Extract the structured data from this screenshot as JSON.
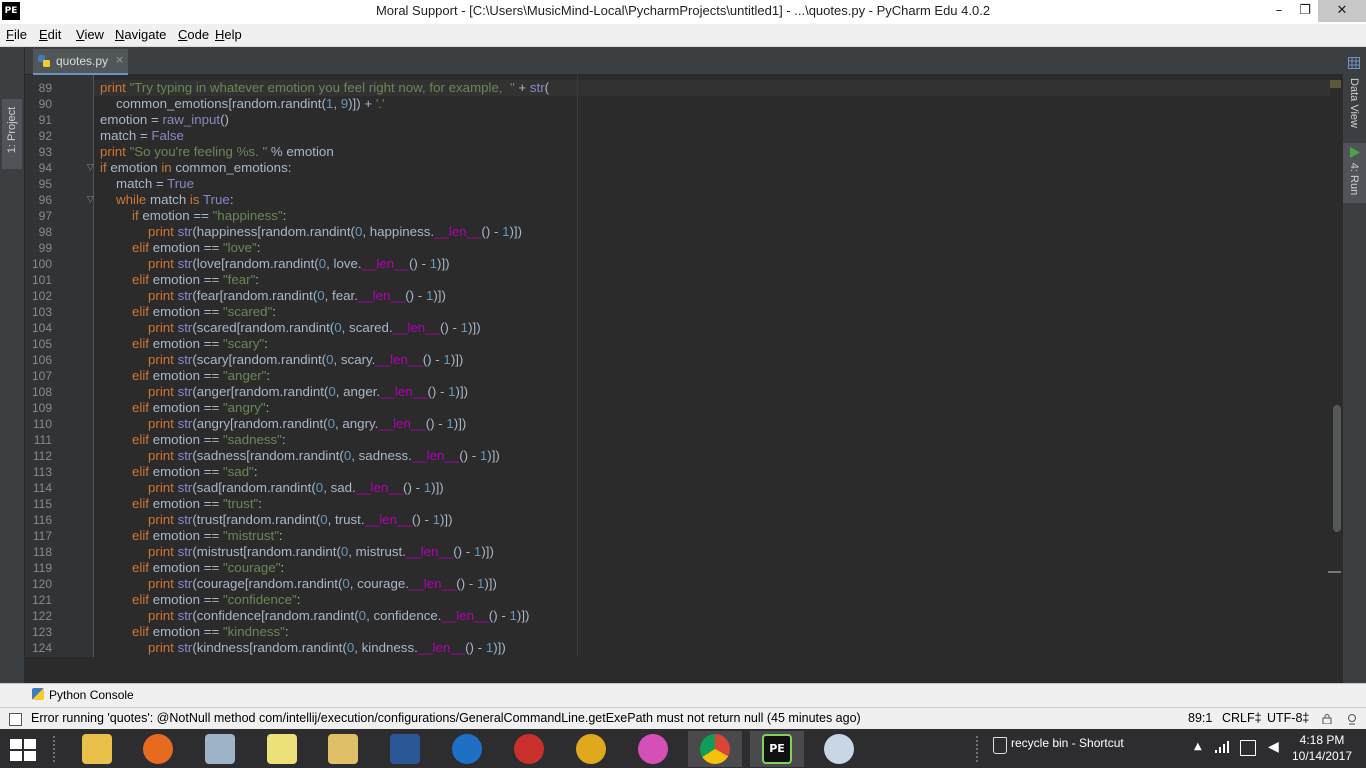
{
  "window": {
    "app_logo": "PE",
    "title": "Moral Support - [C:\\Users\\MusicMind-Local\\PycharmProjects\\untitled1] - ...\\quotes.py - PyCharm Edu 4.0.2",
    "minimize": "–",
    "maximize": "❐",
    "close": "✕"
  },
  "menu": {
    "file": {
      "u": "F",
      "rest": "ile"
    },
    "edit": {
      "u": "E",
      "rest": "dit"
    },
    "view": {
      "u": "V",
      "rest": "iew"
    },
    "navigate": {
      "u": "N",
      "rest": "avigate"
    },
    "code": {
      "u": "C",
      "rest": "ode"
    },
    "help": {
      "u": "H",
      "rest": "elp"
    }
  },
  "tool_windows": {
    "project": "1: Project",
    "data_view": "Data View",
    "run": "4: Run",
    "python_console": "Python Console"
  },
  "editor": {
    "tab_label": "quotes.py",
    "tab_close": "×",
    "line_numbers": [
      "89",
      "90",
      "91",
      "92",
      "93",
      "94",
      "95",
      "96",
      "97",
      "98",
      "99",
      "100",
      "101",
      "102",
      "103",
      "104",
      "105",
      "106",
      "107",
      "108",
      "109",
      "110",
      "111",
      "112",
      "113",
      "114",
      "115",
      "116",
      "117",
      "118",
      "119",
      "120",
      "121",
      "122",
      "123",
      "124"
    ],
    "lines": [
      {
        "indent": 0,
        "tokens": [
          [
            "kw",
            "print "
          ],
          [
            "st",
            "\"Try typing in whatever emotion you feel right now, for example,  \""
          ],
          [
            "op",
            " + "
          ],
          [
            "bi",
            "str"
          ],
          [
            "op",
            "("
          ]
        ]
      },
      {
        "indent": 1,
        "tokens": [
          [
            "op",
            "common_emotions[random.randint("
          ],
          [
            "nm",
            "1"
          ],
          [
            "op",
            ", "
          ],
          [
            "nm",
            "9"
          ],
          [
            "op",
            ")]) + "
          ],
          [
            "st",
            "'.'"
          ]
        ]
      },
      {
        "indent": 0,
        "tokens": [
          [
            "op",
            "emotion = "
          ],
          [
            "bi",
            "raw_input"
          ],
          [
            "op",
            "()"
          ]
        ]
      },
      {
        "indent": 0,
        "tokens": [
          [
            "op",
            "match = "
          ],
          [
            "bi",
            "False"
          ]
        ]
      },
      {
        "indent": 0,
        "tokens": [
          [
            "kw",
            "print "
          ],
          [
            "st",
            "\"So you're feeling %s. \""
          ],
          [
            "op",
            " % emotion"
          ]
        ]
      },
      {
        "indent": 0,
        "tokens": [
          [
            "kw",
            "if "
          ],
          [
            "op",
            "emotion "
          ],
          [
            "kw",
            "in "
          ],
          [
            "op",
            "common_emotions:"
          ]
        ]
      },
      {
        "indent": 1,
        "tokens": [
          [
            "op",
            "match = "
          ],
          [
            "bi",
            "True"
          ]
        ]
      },
      {
        "indent": 1,
        "tokens": [
          [
            "kw",
            "while "
          ],
          [
            "op",
            "match "
          ],
          [
            "kw",
            "is "
          ],
          [
            "bi",
            "True"
          ],
          [
            "op",
            ":"
          ]
        ]
      },
      {
        "indent": 2,
        "tokens": [
          [
            "kw",
            "if "
          ],
          [
            "op",
            "emotion == "
          ],
          [
            "st",
            "\"happiness\""
          ],
          [
            "op",
            ":"
          ]
        ]
      },
      {
        "indent": 3,
        "tokens": [
          [
            "kw",
            "print "
          ],
          [
            "bi",
            "str"
          ],
          [
            "op",
            "(happiness[random.randint("
          ],
          [
            "nm",
            "0"
          ],
          [
            "op",
            ", happiness."
          ],
          [
            "du",
            "__len__"
          ],
          [
            "op",
            "() - "
          ],
          [
            "nm",
            "1"
          ],
          [
            "op",
            ")])"
          ]
        ]
      },
      {
        "indent": 2,
        "tokens": [
          [
            "kw",
            "elif "
          ],
          [
            "op",
            "emotion == "
          ],
          [
            "st",
            "\"love\""
          ],
          [
            "op",
            ":"
          ]
        ]
      },
      {
        "indent": 3,
        "tokens": [
          [
            "kw",
            "print "
          ],
          [
            "bi",
            "str"
          ],
          [
            "op",
            "(love[random.randint("
          ],
          [
            "nm",
            "0"
          ],
          [
            "op",
            ", love."
          ],
          [
            "du",
            "__len__"
          ],
          [
            "op",
            "() - "
          ],
          [
            "nm",
            "1"
          ],
          [
            "op",
            ")])"
          ]
        ]
      },
      {
        "indent": 2,
        "tokens": [
          [
            "kw",
            "elif "
          ],
          [
            "op",
            "emotion == "
          ],
          [
            "st",
            "\"fear\""
          ],
          [
            "op",
            ":"
          ]
        ]
      },
      {
        "indent": 3,
        "tokens": [
          [
            "kw",
            "print "
          ],
          [
            "bi",
            "str"
          ],
          [
            "op",
            "(fear[random.randint("
          ],
          [
            "nm",
            "0"
          ],
          [
            "op",
            ", fear."
          ],
          [
            "du",
            "__len__"
          ],
          [
            "op",
            "() - "
          ],
          [
            "nm",
            "1"
          ],
          [
            "op",
            ")])"
          ]
        ]
      },
      {
        "indent": 2,
        "tokens": [
          [
            "kw",
            "elif "
          ],
          [
            "op",
            "emotion == "
          ],
          [
            "st",
            "\"scared\""
          ],
          [
            "op",
            ":"
          ]
        ]
      },
      {
        "indent": 3,
        "tokens": [
          [
            "kw",
            "print "
          ],
          [
            "bi",
            "str"
          ],
          [
            "op",
            "(scared[random.randint("
          ],
          [
            "nm",
            "0"
          ],
          [
            "op",
            ", scared."
          ],
          [
            "du",
            "__len__"
          ],
          [
            "op",
            "() - "
          ],
          [
            "nm",
            "1"
          ],
          [
            "op",
            ")])"
          ]
        ]
      },
      {
        "indent": 2,
        "tokens": [
          [
            "kw",
            "elif "
          ],
          [
            "op",
            "emotion == "
          ],
          [
            "st",
            "\"scary\""
          ],
          [
            "op",
            ":"
          ]
        ]
      },
      {
        "indent": 3,
        "tokens": [
          [
            "kw",
            "print "
          ],
          [
            "bi",
            "str"
          ],
          [
            "op",
            "(scary[random.randint("
          ],
          [
            "nm",
            "0"
          ],
          [
            "op",
            ", scary."
          ],
          [
            "du",
            "__len__"
          ],
          [
            "op",
            "() - "
          ],
          [
            "nm",
            "1"
          ],
          [
            "op",
            ")])"
          ]
        ]
      },
      {
        "indent": 2,
        "tokens": [
          [
            "kw",
            "elif "
          ],
          [
            "op",
            "emotion == "
          ],
          [
            "st",
            "\"anger\""
          ],
          [
            "op",
            ":"
          ]
        ]
      },
      {
        "indent": 3,
        "tokens": [
          [
            "kw",
            "print "
          ],
          [
            "bi",
            "str"
          ],
          [
            "op",
            "(anger[random.randint("
          ],
          [
            "nm",
            "0"
          ],
          [
            "op",
            ", anger."
          ],
          [
            "du",
            "__len__"
          ],
          [
            "op",
            "() - "
          ],
          [
            "nm",
            "1"
          ],
          [
            "op",
            ")])"
          ]
        ]
      },
      {
        "indent": 2,
        "tokens": [
          [
            "kw",
            "elif "
          ],
          [
            "op",
            "emotion == "
          ],
          [
            "st",
            "\"angry\""
          ],
          [
            "op",
            ":"
          ]
        ]
      },
      {
        "indent": 3,
        "tokens": [
          [
            "kw",
            "print "
          ],
          [
            "bi",
            "str"
          ],
          [
            "op",
            "(angry[random.randint("
          ],
          [
            "nm",
            "0"
          ],
          [
            "op",
            ", angry."
          ],
          [
            "du",
            "__len__"
          ],
          [
            "op",
            "() - "
          ],
          [
            "nm",
            "1"
          ],
          [
            "op",
            ")])"
          ]
        ]
      },
      {
        "indent": 2,
        "tokens": [
          [
            "kw",
            "elif "
          ],
          [
            "op",
            "emotion == "
          ],
          [
            "st",
            "\"sadness\""
          ],
          [
            "op",
            ":"
          ]
        ]
      },
      {
        "indent": 3,
        "tokens": [
          [
            "kw",
            "print "
          ],
          [
            "bi",
            "str"
          ],
          [
            "op",
            "(sadness[random.randint("
          ],
          [
            "nm",
            "0"
          ],
          [
            "op",
            ", sadness."
          ],
          [
            "du",
            "__len__"
          ],
          [
            "op",
            "() - "
          ],
          [
            "nm",
            "1"
          ],
          [
            "op",
            ")])"
          ]
        ]
      },
      {
        "indent": 2,
        "tokens": [
          [
            "kw",
            "elif "
          ],
          [
            "op",
            "emotion == "
          ],
          [
            "st",
            "\"sad\""
          ],
          [
            "op",
            ":"
          ]
        ]
      },
      {
        "indent": 3,
        "tokens": [
          [
            "kw",
            "print "
          ],
          [
            "bi",
            "str"
          ],
          [
            "op",
            "(sad[random.randint("
          ],
          [
            "nm",
            "0"
          ],
          [
            "op",
            ", sad."
          ],
          [
            "du",
            "__len__"
          ],
          [
            "op",
            "() - "
          ],
          [
            "nm",
            "1"
          ],
          [
            "op",
            ")])"
          ]
        ]
      },
      {
        "indent": 2,
        "tokens": [
          [
            "kw",
            "elif "
          ],
          [
            "op",
            "emotion == "
          ],
          [
            "st",
            "\"trust\""
          ],
          [
            "op",
            ":"
          ]
        ]
      },
      {
        "indent": 3,
        "tokens": [
          [
            "kw",
            "print "
          ],
          [
            "bi",
            "str"
          ],
          [
            "op",
            "(trust[random.randint("
          ],
          [
            "nm",
            "0"
          ],
          [
            "op",
            ", trust."
          ],
          [
            "du",
            "__len__"
          ],
          [
            "op",
            "() - "
          ],
          [
            "nm",
            "1"
          ],
          [
            "op",
            ")])"
          ]
        ]
      },
      {
        "indent": 2,
        "tokens": [
          [
            "kw",
            "elif "
          ],
          [
            "op",
            "emotion == "
          ],
          [
            "st",
            "\"mistrust\""
          ],
          [
            "op",
            ":"
          ]
        ]
      },
      {
        "indent": 3,
        "tokens": [
          [
            "kw",
            "print "
          ],
          [
            "bi",
            "str"
          ],
          [
            "op",
            "(mistrust[random.randint("
          ],
          [
            "nm",
            "0"
          ],
          [
            "op",
            ", mistrust."
          ],
          [
            "du",
            "__len__"
          ],
          [
            "op",
            "() - "
          ],
          [
            "nm",
            "1"
          ],
          [
            "op",
            ")])"
          ]
        ]
      },
      {
        "indent": 2,
        "tokens": [
          [
            "kw",
            "elif "
          ],
          [
            "op",
            "emotion == "
          ],
          [
            "st",
            "\"courage\""
          ],
          [
            "op",
            ":"
          ]
        ]
      },
      {
        "indent": 3,
        "tokens": [
          [
            "kw",
            "print "
          ],
          [
            "bi",
            "str"
          ],
          [
            "op",
            "(courage[random.randint("
          ],
          [
            "nm",
            "0"
          ],
          [
            "op",
            ", courage."
          ],
          [
            "du",
            "__len__"
          ],
          [
            "op",
            "() - "
          ],
          [
            "nm",
            "1"
          ],
          [
            "op",
            ")])"
          ]
        ]
      },
      {
        "indent": 2,
        "tokens": [
          [
            "kw",
            "elif "
          ],
          [
            "op",
            "emotion == "
          ],
          [
            "st",
            "\"confidence\""
          ],
          [
            "op",
            ":"
          ]
        ]
      },
      {
        "indent": 3,
        "tokens": [
          [
            "kw",
            "print "
          ],
          [
            "bi",
            "str"
          ],
          [
            "op",
            "(confidence[random.randint("
          ],
          [
            "nm",
            "0"
          ],
          [
            "op",
            ", confidence."
          ],
          [
            "du",
            "__len__"
          ],
          [
            "op",
            "() - "
          ],
          [
            "nm",
            "1"
          ],
          [
            "op",
            ")])"
          ]
        ]
      },
      {
        "indent": 2,
        "tokens": [
          [
            "kw",
            "elif "
          ],
          [
            "op",
            "emotion == "
          ],
          [
            "st",
            "\"kindness\""
          ],
          [
            "op",
            ":"
          ]
        ]
      },
      {
        "indent": 3,
        "tokens": [
          [
            "kw",
            "print "
          ],
          [
            "bi",
            "str"
          ],
          [
            "op",
            "(kindness[random.randint("
          ],
          [
            "nm",
            "0"
          ],
          [
            "op",
            ", kindness."
          ],
          [
            "du",
            "__len__"
          ],
          [
            "op",
            "() - "
          ],
          [
            "nm",
            "1"
          ],
          [
            "op",
            ")])"
          ]
        ]
      }
    ]
  },
  "status": {
    "message": "Error running 'quotes': @NotNull method com/intellij/execution/configurations/GeneralCommandLine.getExePath must not return null (45 minutes ago)",
    "position": "89:1",
    "line_separator": "CRLF‡",
    "encoding": "UTF-8‡"
  },
  "taskbar": {
    "pycharm_label": "PE",
    "recycle_bin": "recycle bin - Shortcut",
    "time": "4:18 PM",
    "date": "10/14/2017"
  },
  "colors": {
    "editor_bg": "#2b2b2b",
    "keyword": "#cc7832",
    "string": "#6a8759",
    "builtin": "#8888c6",
    "number": "#6897bb",
    "dunder": "#b200b2",
    "default": "#a9b7c6"
  },
  "icons": {
    "tab_file": "python-file-icon",
    "console": "python-console-icon",
    "start": "windows-start-icon"
  }
}
